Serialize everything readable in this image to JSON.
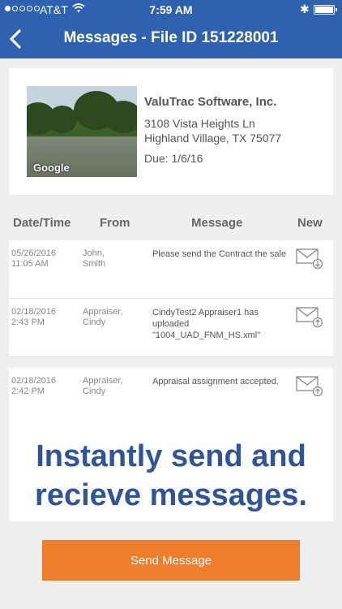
{
  "status_bar": {
    "carrier": "AT&T",
    "time": "7:59 AM"
  },
  "nav": {
    "title": "Messages - File ID 151228001"
  },
  "property": {
    "photo_caption": "Google",
    "company": "ValuTrac Software, Inc.",
    "address_line1": "3108 Vista Heights Ln",
    "address_line2": "Highland Village, TX 75077",
    "due": "Due: 1/6/16"
  },
  "table": {
    "headers": {
      "date": "Date/Time",
      "from": "From",
      "message": "Message",
      "new": "New"
    },
    "rows": [
      {
        "date": "05/26/2016",
        "time": "11:05 AM",
        "from1": "John,",
        "from2": "Smith",
        "message": "Please send the Contract the sale",
        "icon": "envelope-down-icon"
      },
      {
        "date": "02/18/2016",
        "time": "2:43 PM",
        "from1": "Appraiser,",
        "from2": "Cindy",
        "message": "CindyTest2 Appraiser1 has uploaded \"1004_UAD_FNM_HS.xml\"",
        "icon": "envelope-up-icon"
      },
      {
        "date": "02/18/2016",
        "time": "2:42 PM",
        "from1": "Appraiser,",
        "from2": "Cindy",
        "message": "Appraisal assignment accepted.",
        "icon": "envelope-up-icon"
      }
    ]
  },
  "promo": {
    "line1": "Instantly send and",
    "line2": "recieve messages."
  },
  "send_button": {
    "label": "Send Message"
  },
  "colors": {
    "header": "#2e62b1",
    "button": "#ef7d2c",
    "promo_text": "#2f5597"
  }
}
